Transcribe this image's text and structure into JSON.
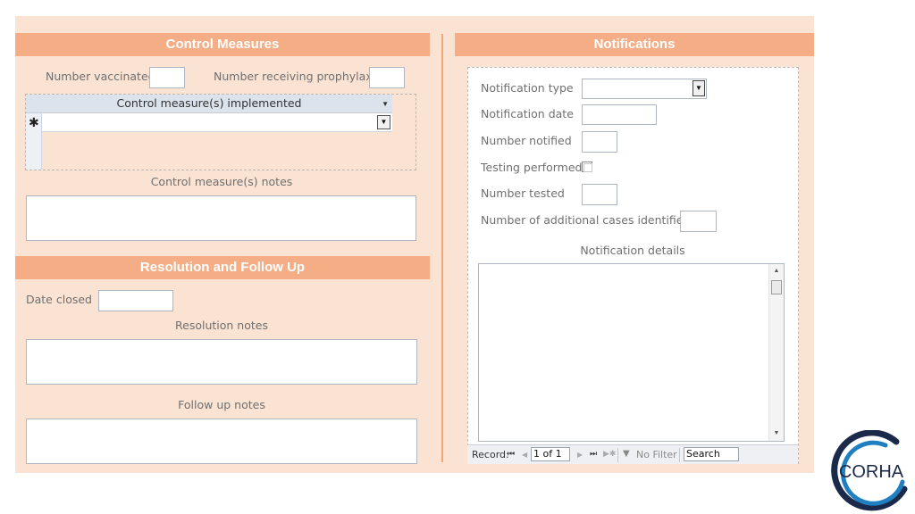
{
  "control_measures": {
    "header": "Control Measures",
    "number_vaccinated_label": "Number vaccinated",
    "number_vaccinated_value": "",
    "number_prophylaxis_label": "Number receiving prophylaxis",
    "number_prophylaxis_value": "",
    "subform": {
      "column_header": "Control measure(s) implemented",
      "new_row_marker": "✱",
      "rows": [
        ""
      ]
    },
    "notes_label": "Control measure(s) notes",
    "notes_value": ""
  },
  "resolution": {
    "header": "Resolution and Follow Up",
    "date_closed_label": "Date closed",
    "date_closed_value": "",
    "resolution_notes_label": "Resolution notes",
    "resolution_notes_value": "",
    "follow_up_notes_label": "Follow up notes",
    "follow_up_notes_value": ""
  },
  "notifications": {
    "header": "Notifications",
    "notification_type_label": "Notification type",
    "notification_type_value": "",
    "notification_date_label": "Notification date",
    "notification_date_value": "",
    "number_notified_label": "Number notified",
    "number_notified_value": "",
    "testing_performed_label": "Testing performed",
    "testing_performed_checked": false,
    "number_tested_label": "Number tested",
    "number_tested_value": "",
    "additional_cases_label": "Number of additional cases identified",
    "additional_cases_value": "",
    "details_label": "Notification details",
    "details_value": ""
  },
  "record_nav": {
    "record_label": "Record:",
    "position": "1 of 1",
    "filter_label": "No Filter",
    "search_text": "Search"
  },
  "logo": {
    "text": "CORHA",
    "icon": "corha-logo"
  },
  "colors": {
    "form_background": "#fbe3d3",
    "header_background": "#f4ad84",
    "header_text": "#ffffff",
    "logo_blue": "#1f7fc1",
    "logo_navy": "#1b2a4a"
  }
}
